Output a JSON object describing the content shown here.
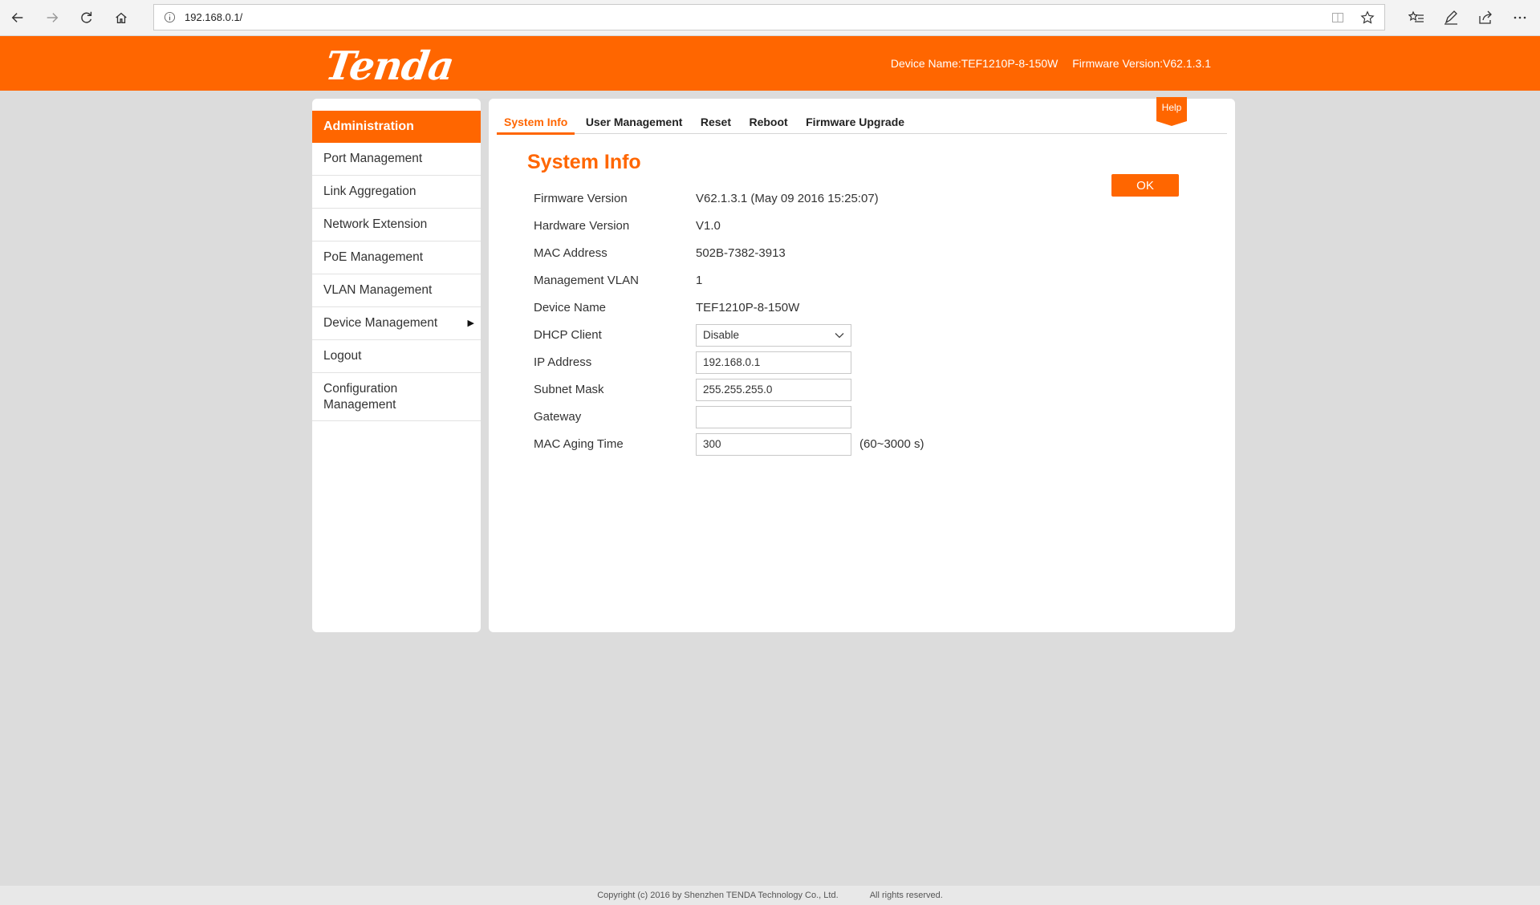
{
  "browser": {
    "url": "192.168.0.1/"
  },
  "header": {
    "logo": "Tenda",
    "device_name": "Device Name:TEF1210P-8-150W",
    "firmware_version": "Firmware Version:V62.1.3.1"
  },
  "sidebar": {
    "heading": "Administration",
    "items": [
      {
        "label": "Port Management"
      },
      {
        "label": "Link Aggregation"
      },
      {
        "label": "Network Extension"
      },
      {
        "label": "PoE Management"
      },
      {
        "label": "VLAN Management"
      },
      {
        "label": "Device Management"
      },
      {
        "label": "Logout"
      },
      {
        "label": "Configuration Management"
      }
    ],
    "submenu_arrow": "▶"
  },
  "tabs": [
    {
      "label": "System Info",
      "active": true
    },
    {
      "label": "User Management"
    },
    {
      "label": "Reset"
    },
    {
      "label": "Reboot"
    },
    {
      "label": "Firmware Upgrade"
    }
  ],
  "help_label": "Help",
  "page_title": "System Info",
  "ok_label": "OK",
  "info": {
    "firmware_version": {
      "label": "Firmware Version",
      "value": "V62.1.3.1 (May 09 2016 15:25:07)"
    },
    "hardware_version": {
      "label": "Hardware Version",
      "value": "V1.0"
    },
    "mac_address": {
      "label": "MAC Address",
      "value": "502B-7382-3913"
    },
    "management_vlan": {
      "label": "Management VLAN",
      "value": "1"
    },
    "device_name": {
      "label": "Device Name",
      "value": "TEF1210P-8-150W"
    }
  },
  "form": {
    "dhcp_client": {
      "label": "DHCP Client",
      "value": "Disable"
    },
    "ip_address": {
      "label": "IP Address",
      "value": "192.168.0.1"
    },
    "subnet_mask": {
      "label": "Subnet Mask",
      "value": "255.255.255.0"
    },
    "gateway": {
      "label": "Gateway",
      "value": ""
    },
    "mac_aging_time": {
      "label": "MAC Aging Time",
      "value": "300",
      "hint": "(60~3000 s)"
    }
  },
  "footer": {
    "copyright": "Copyright (c) 2016 by Shenzhen TENDA Technology Co., Ltd.",
    "rights": "All rights reserved."
  },
  "colors": {
    "brand_orange": "#ff6600",
    "page_background": "#dcdcdc"
  }
}
